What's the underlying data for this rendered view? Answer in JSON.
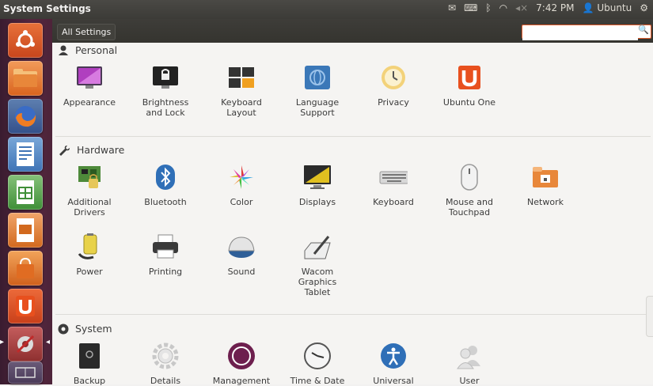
{
  "window": {
    "title": "System Settings"
  },
  "panel": {
    "time": "7:42 PM",
    "user": "Ubuntu"
  },
  "toolbar": {
    "all_settings_label": "All Settings",
    "search_placeholder": ""
  },
  "sections": {
    "personal": {
      "title": "Personal",
      "items": [
        "Appearance",
        "Brightness\nand Lock",
        "Keyboard\nLayout",
        "Language\nSupport",
        "Privacy",
        "Ubuntu One"
      ]
    },
    "hardware": {
      "title": "Hardware",
      "items": [
        "Additional\nDrivers",
        "Bluetooth",
        "Color",
        "Displays",
        "Keyboard",
        "Mouse and\nTouchpad",
        "Network",
        "Power",
        "Printing",
        "Sound",
        "Wacom\nGraphics\nTablet"
      ]
    },
    "system": {
      "title": "System",
      "items": [
        "Backup",
        "Details",
        "Management",
        "Time & Date",
        "Universal",
        "User"
      ]
    }
  },
  "colors": {
    "accent": "#e05a2a",
    "launcher": "#4d2439",
    "topbar": "#3c3b37"
  }
}
